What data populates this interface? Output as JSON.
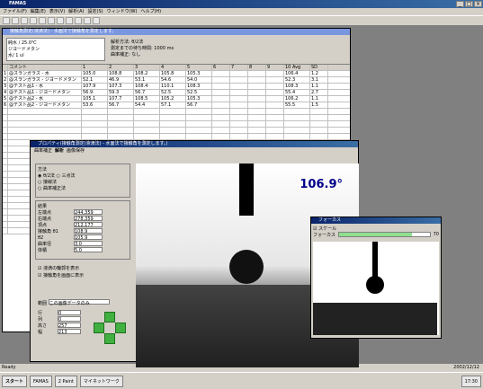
{
  "app": {
    "title": "FAMAS"
  },
  "menu": [
    "ファイル(F)",
    "編集(E)",
    "表示(V)",
    "解析(A)",
    "設定(S)",
    "ウィンドウ(W)",
    "ヘルプ(H)"
  ],
  "child": {
    "title": "接触角測定(液滴法) - 水面法で接触角を測定します。",
    "list": [
      "純水 / 25.0℃",
      "ジヨードメタン",
      "水/ 1 ul"
    ],
    "info": [
      {
        "k": "解析方法:",
        "v": "θ/2法"
      },
      {
        "k": "測定までの待ち時間:",
        "v": "1000 ms"
      },
      {
        "k": "曲率補正:",
        "v": "なし"
      }
    ],
    "colhdr": [
      "コメント",
      "1",
      "2",
      "3",
      "4",
      "5",
      "6",
      "7",
      "8",
      "9",
      "10 Avg",
      "SD"
    ],
    "rows": [
      [
        "1",
        "@スランガラス - 水",
        "105.0",
        "108.8",
        "108.2",
        "105.8",
        "105.3",
        "106.4",
        "1.2"
      ],
      [
        "2",
        "@スランガラス - ジヨードメタン",
        "52.1",
        "46.9",
        "53.1",
        "54.6",
        "54.0",
        "52.3",
        "3.1"
      ],
      [
        "3",
        "@テスト品1 - 水",
        "107.9",
        "107.3",
        "108.4",
        "110.1",
        "108.3",
        "108.3",
        "1.1"
      ],
      [
        "4",
        "@テスト品1 - ジヨードメタン",
        "56.9",
        "59.3",
        "56.7",
        "52.5",
        "52.5",
        "55.4",
        "2.7"
      ],
      [
        "5",
        "@テスト品2 - 水",
        "105.1",
        "107.7",
        "108.5",
        "105.2",
        "105.3",
        "106.2",
        "1.1"
      ],
      [
        "6",
        "@テスト品2 - ジヨードメタン",
        "53.6",
        "56.7",
        "54.4",
        "57.1",
        "56.7",
        "55.5",
        "1.5"
      ]
    ]
  },
  "prop": {
    "title": "プロパティ(接触角測定(液滴法) - 水面法で接触角を測定します。)",
    "tabs": [
      "曲率補正",
      "解析",
      "画像保存"
    ],
    "method_label": "方法",
    "methods": [
      "θ/2法",
      "三点法",
      "接線法",
      "曲率補正法"
    ],
    "result_label": "結果",
    "results": [
      {
        "k": "左端点",
        "v": "244,359"
      },
      {
        "k": "右端点",
        "v": "278,359"
      },
      {
        "k": "頂点",
        "v": "212,177"
      },
      {
        "k": "接触角 θ1",
        "v": "108.9"
      },
      {
        "k": "θ2",
        "v": "105.9"
      },
      {
        "k": "曲率径",
        "v": "3.0"
      },
      {
        "k": "体積",
        "v": "5.0"
      }
    ],
    "chk1": "液滴の輪郭を表示",
    "chk2": "接触角を画面に表示",
    "roi_label": "範囲",
    "roi_select": "この画像データのみ",
    "roi": [
      {
        "k": "行",
        "v": "0"
      },
      {
        "k": "列",
        "v": "0"
      },
      {
        "k": "高さ",
        "v": "257"
      },
      {
        "k": "幅",
        "v": "213"
      }
    ],
    "angle": "106.9°"
  },
  "focus": {
    "title": "フォーカス",
    "scale_label": "スケール",
    "focus_label": "フォーカス",
    "focus_val": "70",
    "focus_fraction": 0.8
  },
  "status": "Ready",
  "taskbar": {
    "start": "スタート",
    "tasks": [
      "FAMAS",
      "2 Paint",
      "マイネットワーク"
    ],
    "clock": "17:30",
    "date": "2002/12/12"
  }
}
